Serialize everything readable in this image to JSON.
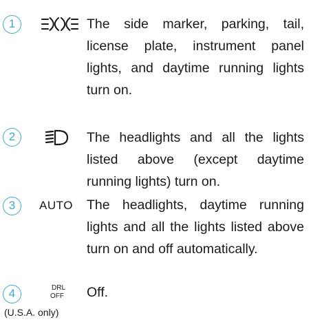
{
  "items": [
    {
      "number": "1",
      "icon": "side-marker-lights-icon",
      "description": "The side marker, parking, tail, license plate, instrument panel lights, and daytime running lights turn on."
    },
    {
      "number": "2",
      "icon": "headlight-icon",
      "description": "The headlights and all the lights listed above (except daytime running lights) turn on."
    },
    {
      "number": "3",
      "label": "AUTO",
      "description": "The headlights, daytime running lights and all the lights listed above turn on and off automatically."
    },
    {
      "number": "4",
      "label_top": "DRL",
      "label_bottom": "OFF",
      "note": "(U.S.A. only)",
      "description": "Off."
    }
  ],
  "colors": {
    "accent": "#3fa9c9",
    "text": "#1a1a1a"
  }
}
